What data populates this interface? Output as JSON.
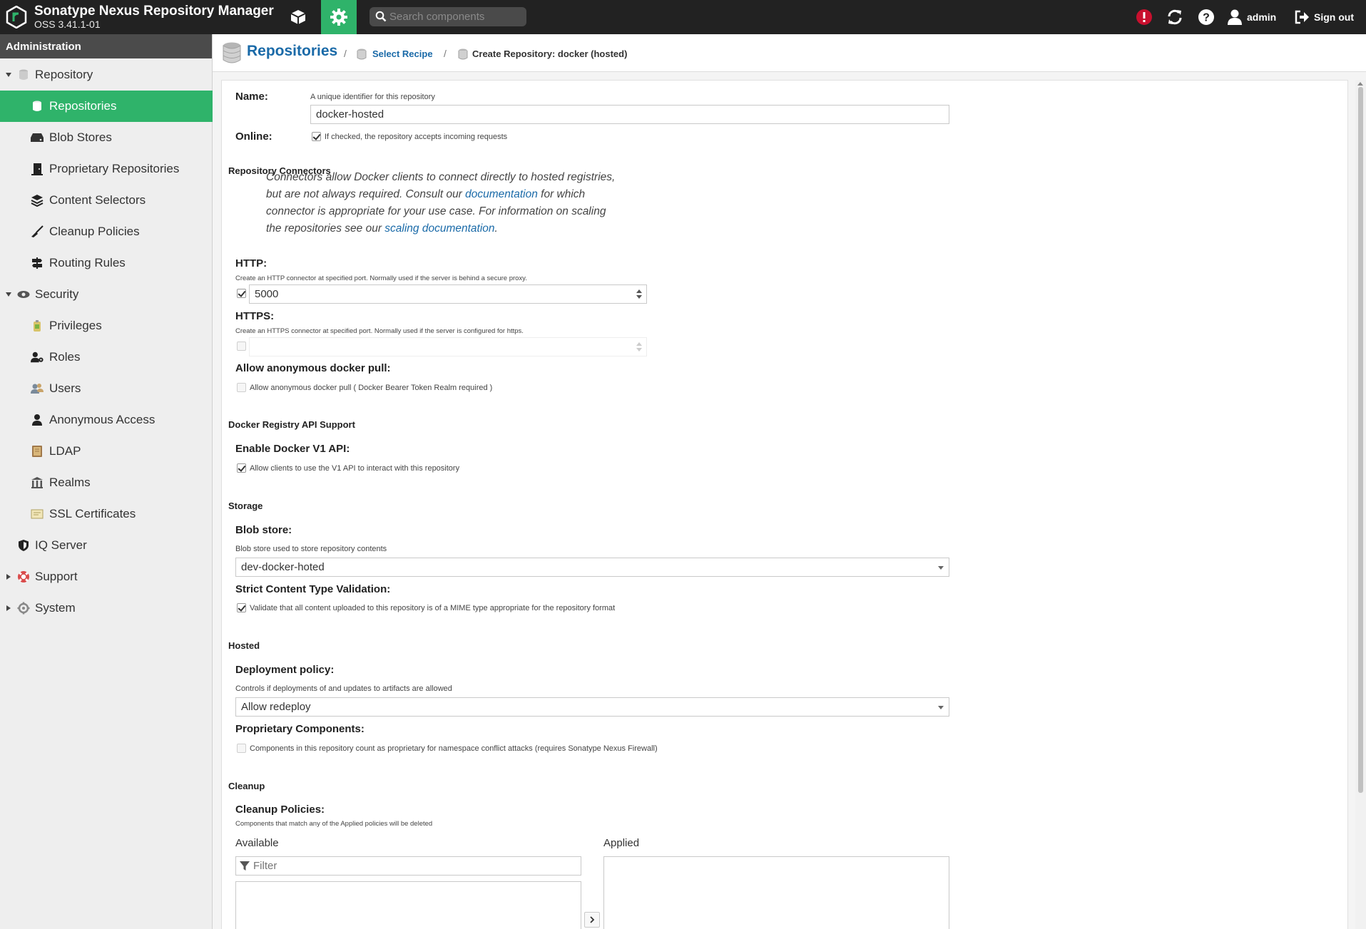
{
  "app": {
    "title": "Sonatype Nexus Repository Manager",
    "version": "OSS 3.41.1-01"
  },
  "topbar": {
    "search_placeholder": "Search components",
    "user_label": "admin",
    "signout_label": "Sign out"
  },
  "sidebar": {
    "header": "Administration",
    "items": [
      {
        "label": "Repository",
        "level": 1,
        "expanded": true,
        "icon": "database-icon"
      },
      {
        "label": "Repositories",
        "level": 2,
        "active": true,
        "icon": "database-icon"
      },
      {
        "label": "Blob Stores",
        "level": 2,
        "icon": "hard-drive-icon"
      },
      {
        "label": "Proprietary Repositories",
        "level": 2,
        "icon": "door-icon"
      },
      {
        "label": "Content Selectors",
        "level": 2,
        "icon": "layers-icon"
      },
      {
        "label": "Cleanup Policies",
        "level": 2,
        "icon": "broom-icon"
      },
      {
        "label": "Routing Rules",
        "level": 2,
        "icon": "signpost-icon"
      },
      {
        "label": "Security",
        "level": 1,
        "expanded": true,
        "icon": "eye-icon"
      },
      {
        "label": "Privileges",
        "level": 2,
        "icon": "badge-icon"
      },
      {
        "label": "Roles",
        "level": 2,
        "icon": "user-gear-icon"
      },
      {
        "label": "Users",
        "level": 2,
        "icon": "users-icon"
      },
      {
        "label": "Anonymous Access",
        "level": 2,
        "icon": "user-icon"
      },
      {
        "label": "LDAP",
        "level": 2,
        "icon": "book-icon"
      },
      {
        "label": "Realms",
        "level": 2,
        "icon": "building-icon"
      },
      {
        "label": "SSL Certificates",
        "level": 2,
        "icon": "certificate-icon"
      },
      {
        "label": "IQ Server",
        "level": 1,
        "icon": "shield-icon"
      },
      {
        "label": "Support",
        "level": 1,
        "expanded": false,
        "icon": "lifebuoy-icon"
      },
      {
        "label": "System",
        "level": 1,
        "expanded": false,
        "icon": "gear-icon"
      }
    ]
  },
  "breadcrumb": {
    "root": "Repositories",
    "recipe": "Select Recipe",
    "current": "Create Repository: docker (hosted)",
    "separator": "/"
  },
  "form": {
    "name": {
      "label": "Name:",
      "help": "A unique identifier for this repository",
      "value": "docker-hosted"
    },
    "online": {
      "label": "Online:",
      "help": "If checked, the repository accepts incoming requests",
      "checked": true
    },
    "connectors": {
      "title": "Repository Connectors",
      "desc_1": "Connectors allow Docker clients to connect directly to hosted registries, but are not always required. Consult our ",
      "link_1": "documentation",
      "desc_2": " for which connector is appropriate for your use case. For information on scaling the repositories see our ",
      "link_2": "scaling documentation",
      "desc_3": ".",
      "http": {
        "label": "HTTP:",
        "help": "Create an HTTP connector at specified port. Normally used if the server is behind a secure proxy.",
        "checked": true,
        "value": "5000"
      },
      "https": {
        "label": "HTTPS:",
        "help": "Create an HTTPS connector at specified port. Normally used if the server is configured for https.",
        "checked": false,
        "value": ""
      },
      "anon": {
        "label": "Allow anonymous docker pull:",
        "help": "Allow anonymous docker pull ( Docker Bearer Token Realm required )",
        "checked": false
      }
    },
    "api": {
      "title": "Docker Registry API Support",
      "v1": {
        "label": "Enable Docker V1 API:",
        "help": "Allow clients to use the V1 API to interact with this repository",
        "checked": true
      }
    },
    "storage": {
      "title": "Storage",
      "blob": {
        "label": "Blob store:",
        "help": "Blob store used to store repository contents",
        "value": "dev-docker-hoted"
      },
      "strict": {
        "label": "Strict Content Type Validation:",
        "help": "Validate that all content uploaded to this repository is of a MIME type appropriate for the repository format",
        "checked": true
      }
    },
    "hosted": {
      "title": "Hosted",
      "deploy": {
        "label": "Deployment policy:",
        "help": "Controls if deployments of and updates to artifacts are allowed",
        "value": "Allow redeploy"
      },
      "proprietary": {
        "label": "Proprietary Components:",
        "help": "Components in this repository count as proprietary for namespace conflict attacks (requires Sonatype Nexus Firewall)",
        "checked": false
      }
    },
    "cleanup": {
      "title": "Cleanup",
      "label": "Cleanup Policies:",
      "help": "Components that match any of the Applied policies will be deleted",
      "available_label": "Available",
      "applied_label": "Applied",
      "filter_placeholder": "Filter"
    }
  },
  "colors": {
    "accent_green": "#2fb36a",
    "topbar_bg": "#222222",
    "link_blue": "#1a6aa8",
    "alert_red": "#c8102e"
  }
}
